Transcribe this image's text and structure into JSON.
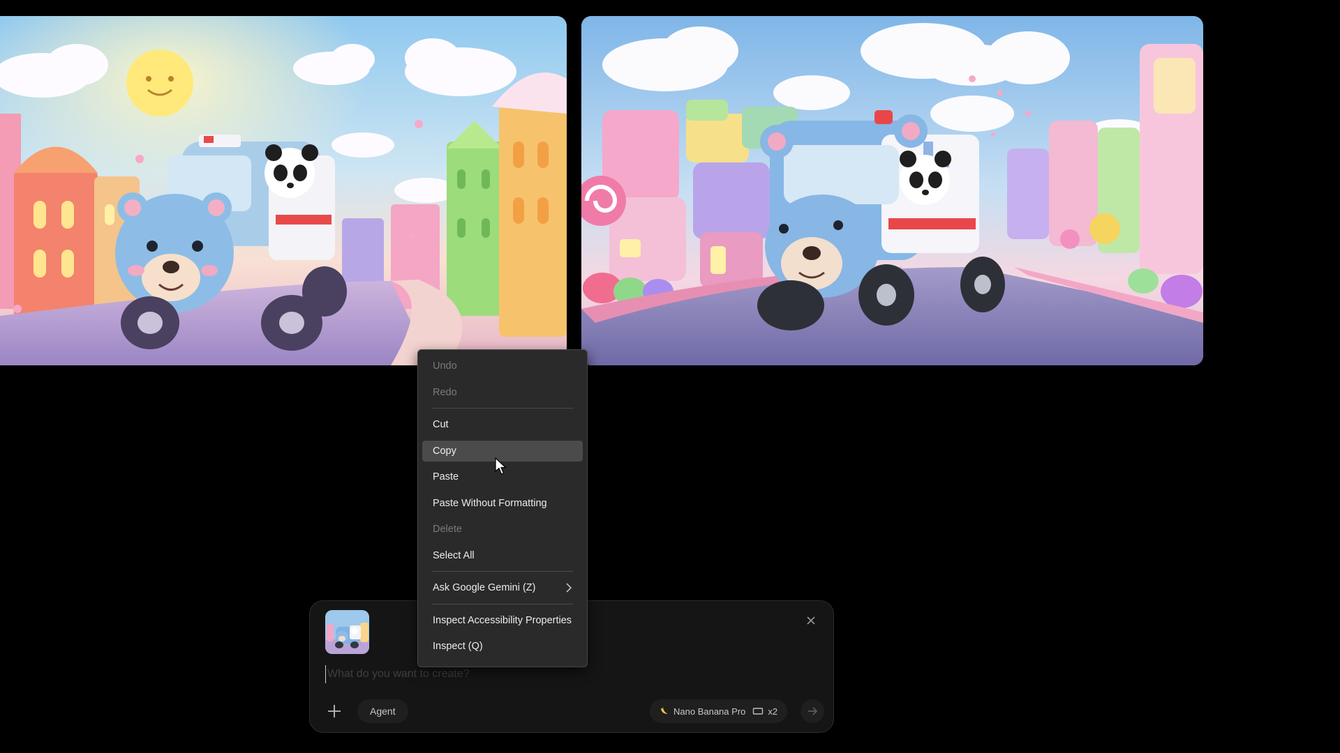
{
  "context_menu": {
    "items": [
      {
        "label": "Undo",
        "enabled": false
      },
      {
        "label": "Redo",
        "enabled": false
      },
      {
        "label": "Cut",
        "enabled": true
      },
      {
        "label": "Copy",
        "enabled": true,
        "highlighted": true
      },
      {
        "label": "Paste",
        "enabled": true
      },
      {
        "label": "Paste Without Formatting",
        "enabled": true
      },
      {
        "label": "Delete",
        "enabled": false
      },
      {
        "label": "Select All",
        "enabled": true
      },
      {
        "label": "Ask Google Gemini (Z)",
        "enabled": true,
        "has_submenu": true
      },
      {
        "label": "Inspect Accessibility Properties",
        "enabled": true
      },
      {
        "label": "Inspect (Q)",
        "enabled": true
      }
    ]
  },
  "composer": {
    "prompt_placeholder": "What do you want to create?",
    "prompt_value": "",
    "agent_label": "Agent",
    "model_label": "Nano Banana Pro",
    "count_label": "x2"
  },
  "colors": {
    "background": "#000000",
    "menu_bg": "#2a2a2a",
    "menu_highlight": "#4b4b4b",
    "composer_bg": "#151515"
  }
}
